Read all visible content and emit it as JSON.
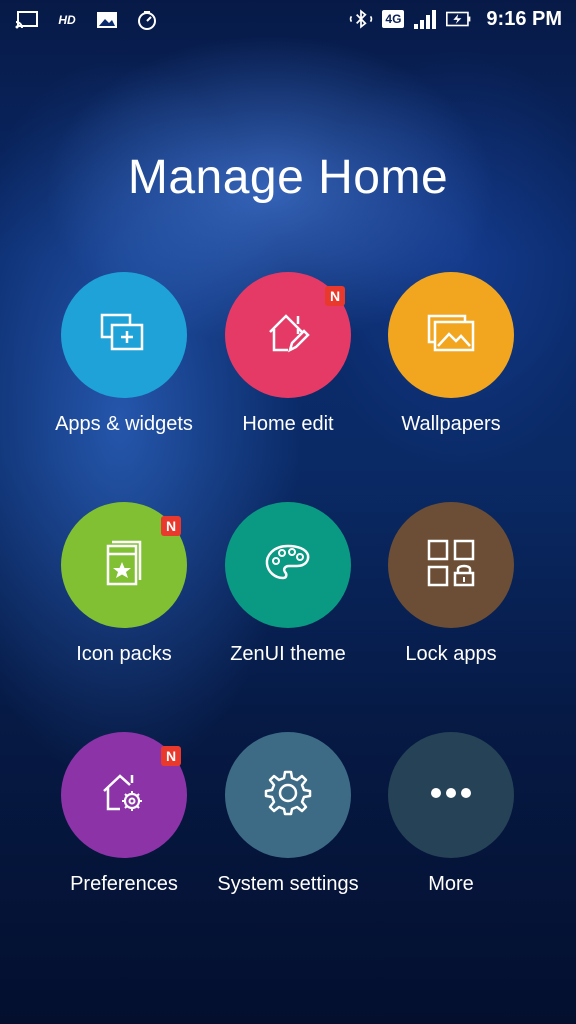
{
  "statusbar": {
    "left_icons": [
      "cast-icon",
      "hd-icon",
      "gallery-icon",
      "timer-icon"
    ],
    "hd_text": "HD",
    "network": "4G",
    "time": "9:16 PM"
  },
  "title": "Manage Home",
  "items": [
    {
      "label": "Apps & widgets",
      "color": "#1ea2d8",
      "icon": "apps-widgets-icon",
      "badge": ""
    },
    {
      "label": "Home edit",
      "color": "#e63a66",
      "icon": "home-edit-icon",
      "badge": "N"
    },
    {
      "label": "Wallpapers",
      "color": "#f2a620",
      "icon": "wallpapers-icon",
      "badge": ""
    },
    {
      "label": "Icon packs",
      "color": "#80c032",
      "icon": "icon-packs-icon",
      "badge": "N"
    },
    {
      "label": "ZenUI theme",
      "color": "#0a9a83",
      "icon": "palette-icon",
      "badge": ""
    },
    {
      "label": "Lock apps",
      "color": "#6b4e35",
      "icon": "lock-apps-icon",
      "badge": ""
    },
    {
      "label": "Preferences",
      "color": "#8c33a8",
      "icon": "preferences-icon",
      "badge": "N"
    },
    {
      "label": "System settings",
      "color": "#3d6b86",
      "icon": "gear-icon",
      "badge": ""
    },
    {
      "label": "More",
      "color": "#264256",
      "icon": "more-icon",
      "badge": ""
    }
  ]
}
